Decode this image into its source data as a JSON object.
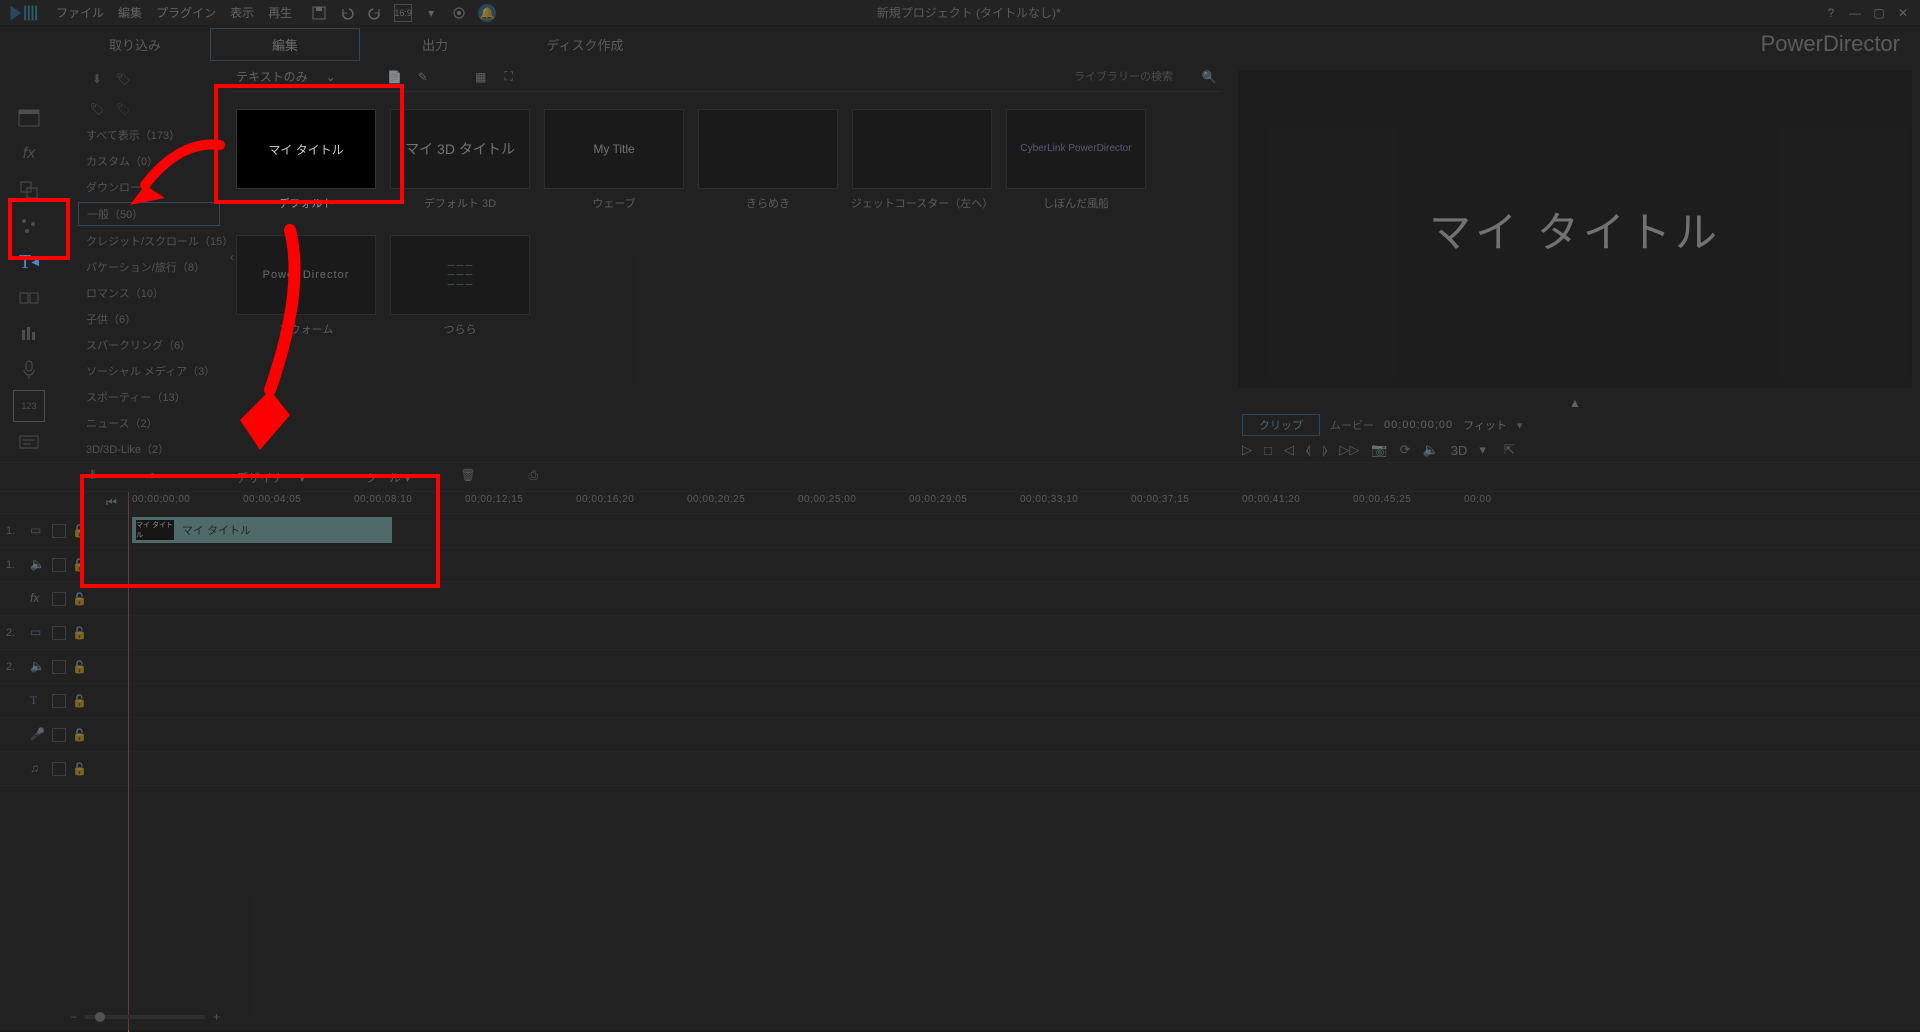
{
  "menubar": {
    "items": [
      "ファイル",
      "編集",
      "プラグイン",
      "表示",
      "再生"
    ],
    "project_title": "新規プロジェクト (タイトルなし)*"
  },
  "tabs": {
    "items": [
      "取り込み",
      "編集",
      "出力",
      "ディスク作成"
    ],
    "active_index": 1
  },
  "brand": "PowerDirector",
  "library": {
    "filter_label": "テキストのみ",
    "search_placeholder": "ライブラリーの検索",
    "categories": [
      "すべて表示（173）",
      "カスタム（0）",
      "ダウンロード",
      "一般（50）",
      "クレジット/スクロール（15）",
      "バケーション/旅行（8）",
      "ロマンス（10）",
      "子供（6）",
      "スパークリング（6）",
      "ソーシャル メディア（3）",
      "スポーティー（13）",
      "ニュース（2）",
      "3D/3D-Like（2）"
    ],
    "selected_category_index": 3,
    "thumbs_row1": [
      {
        "preview": "マイ タイトル",
        "label": "デフォルト",
        "highlighted": true
      },
      {
        "preview": "マイ 3D タイトル",
        "label": "デフォルト 3D"
      },
      {
        "preview": "My Title",
        "label": "ウェーブ"
      },
      {
        "preview": "",
        "label": "きらめき"
      }
    ],
    "thumbs_row2": [
      {
        "preview": "",
        "label": "ジェットコースター（左へ）"
      },
      {
        "preview": "CyberLink PowerDirector",
        "label": "しぼんだ風船",
        "style": "cyber"
      },
      {
        "preview": "Power Director",
        "label": "スウォーム",
        "style": "pd"
      },
      {
        "preview": "",
        "label": "つらら",
        "style": "lines"
      }
    ]
  },
  "preview": {
    "text": "マイ タイトル",
    "clip_label": "クリップ",
    "movie_label": "ムービー",
    "timecode": "00;00;00;00",
    "fit_label": "フィット",
    "threeD_label": "3D"
  },
  "designer_row": {
    "designer": "デザイナー",
    "tool": "ツール"
  },
  "timeline": {
    "ticks": [
      "00;00;00;00",
      "00;00;04;05",
      "00;00;08;10",
      "00;00;12;15",
      "00;00;16;20",
      "00;00;20;25",
      "00;00;25;00",
      "00;00;29;05",
      "00;00;33;10",
      "00;00;37;15",
      "00;00;41;20",
      "00;00;45;25",
      "00;00"
    ],
    "clip": {
      "thumb_text": "マイ タイトル",
      "label": "マイ タイトル"
    },
    "tracks": [
      {
        "num": "1.",
        "type": "video"
      },
      {
        "num": "1.",
        "type": "audio"
      },
      {
        "num": "",
        "type": "fx"
      },
      {
        "num": "2.",
        "type": "video"
      },
      {
        "num": "2.",
        "type": "audio"
      },
      {
        "num": "",
        "type": "title"
      },
      {
        "num": "",
        "type": "voice"
      },
      {
        "num": "",
        "type": "music"
      }
    ]
  }
}
